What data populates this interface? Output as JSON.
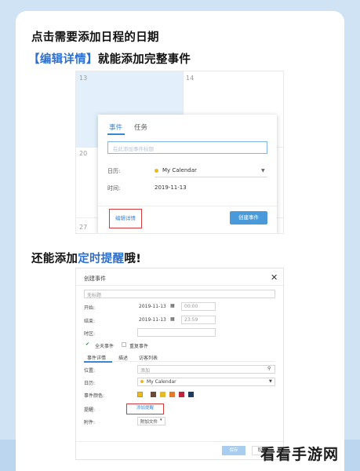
{
  "headings": {
    "line1": "点击需要添加日程的日期",
    "line2_open": "【",
    "line2_highlight": "编辑详情",
    "line2_close": "】",
    "line2_rest": "就能添加完整事件",
    "line3_prefix": "还能添加",
    "line3_highlight": "定时提醒",
    "line3_suffix": "哦!"
  },
  "calendar": {
    "days": [
      "13",
      "14",
      "20",
      "27"
    ],
    "popup": {
      "tabs": [
        "事件",
        "任务"
      ],
      "title_placeholder": "在此添加事件标题",
      "calendar_label": "日历:",
      "calendar_value": "My Calendar",
      "time_label": "时间:",
      "time_value": "2019-11-13",
      "edit_details": "编辑详情",
      "create_event": "创建事件"
    }
  },
  "dialog": {
    "title": "创建事件",
    "event_title_placeholder": "无标题",
    "start_label": "开始:",
    "start_date": "2019-11-13",
    "start_time": "00:00",
    "end_label": "结束:",
    "end_date": "2019-11-13",
    "end_time": "23:59",
    "timezone_label": "时区:",
    "all_day": "全天事件",
    "repeat": "重复事件",
    "tabs": [
      "事件详情",
      "描述",
      "访客列表"
    ],
    "location_label": "位置:",
    "location_placeholder": "添加",
    "calendar_label": "日历:",
    "calendar_value": "My Calendar",
    "color_label": "事件颜色:",
    "colors": [
      "#e8b923",
      "#6b4a3a",
      "#e8b923",
      "#e07b2a",
      "#c0243a",
      "#1f3b5a"
    ],
    "reminder_label": "提醒:",
    "add_reminder": "添加提醒",
    "attachment_label": "附件:",
    "add_file": "附加文件",
    "save": "保存",
    "cancel": "取消"
  },
  "watermark": "看看手游网"
}
